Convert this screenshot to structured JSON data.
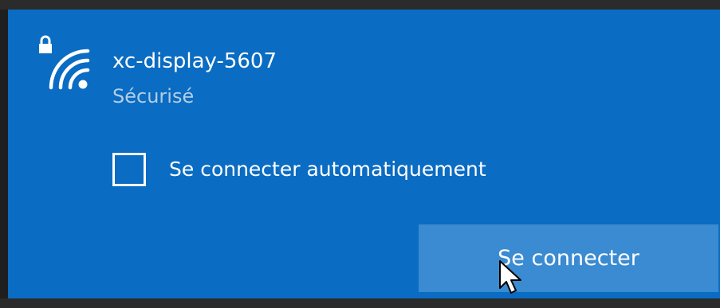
{
  "network": {
    "name": "xc-display-5607",
    "status": "Sécurisé",
    "icon": "wifi-secured-icon"
  },
  "auto_connect": {
    "label": "Se connecter automatiquement",
    "checked": false
  },
  "actions": {
    "connect_label": "Se connecter"
  },
  "colors": {
    "panel_background": "#0a6cc2",
    "button_background": "#3a8bd1",
    "status_text": "#b4cde6",
    "text": "#ffffff",
    "window_frame": "#1f1f1f"
  }
}
